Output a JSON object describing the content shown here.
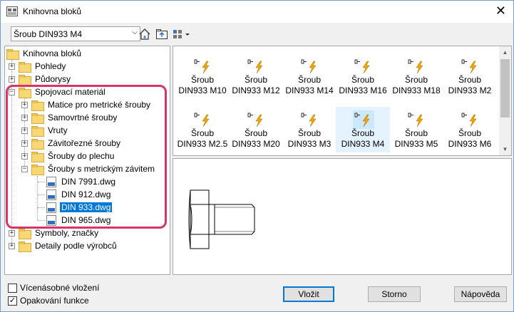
{
  "window": {
    "title": "Knihovna bloků",
    "close_glyph": "✕"
  },
  "toolbar": {
    "combo_value": "Šroub DIN933 M4",
    "icons": [
      "home-icon",
      "folder-up-icon",
      "view-options-icon"
    ]
  },
  "tree": {
    "items": [
      {
        "label": "Knihovna bloků",
        "icon": "folder"
      },
      {
        "label": "Pohledy",
        "icon": "folder",
        "expander": "+"
      },
      {
        "label": "Půdorysy",
        "icon": "folder",
        "expander": "+"
      },
      {
        "label": "Spojovací materiál",
        "icon": "folder",
        "expander": "−"
      },
      {
        "label": "Matice pro metrické šrouby",
        "icon": "folder",
        "expander": "+"
      },
      {
        "label": "Samovrtné šrouby",
        "icon": "folder",
        "expander": "+"
      },
      {
        "label": "Vruty",
        "icon": "folder",
        "expander": "+"
      },
      {
        "label": "Závitořezné šrouby",
        "icon": "folder",
        "expander": "+"
      },
      {
        "label": "Šrouby do plechu",
        "icon": "folder",
        "expander": "+"
      },
      {
        "label": "Šrouby s metrickým závitem",
        "icon": "folder",
        "expander": "−"
      },
      {
        "label": "DIN 7991.dwg",
        "icon": "dwg"
      },
      {
        "label": "DIN 912.dwg",
        "icon": "dwg"
      },
      {
        "label": "DIN 933.dwg",
        "icon": "dwg",
        "selected": true
      },
      {
        "label": "DIN 965.dwg",
        "icon": "dwg"
      },
      {
        "label": "Symboly, značky",
        "icon": "folder",
        "expander": "+"
      },
      {
        "label": "Detaily podle výrobců",
        "icon": "folder",
        "expander": "+"
      }
    ]
  },
  "blocks": {
    "items": [
      {
        "line1": "Šroub",
        "line2": "DIN933 M10"
      },
      {
        "line1": "Šroub",
        "line2": "DIN933 M12"
      },
      {
        "line1": "Šroub",
        "line2": "DIN933 M14"
      },
      {
        "line1": "Šroub",
        "line2": "DIN933 M16"
      },
      {
        "line1": "Šroub",
        "line2": "DIN933 M18"
      },
      {
        "line1": "Šroub",
        "line2": "DIN933 M2"
      },
      {
        "line1": "Šroub",
        "line2": "DIN933 M2.5"
      },
      {
        "line1": "Šroub",
        "line2": "DIN933 M20"
      },
      {
        "line1": "Šroub",
        "line2": "DIN933 M3"
      },
      {
        "line1": "Šroub",
        "line2": "DIN933 M4",
        "selected": true
      },
      {
        "line1": "Šroub",
        "line2": "DIN933 M5"
      },
      {
        "line1": "Šroub",
        "line2": "DIN933 M6"
      }
    ]
  },
  "options": {
    "multi_insert_label": "Vícenásobné vložení",
    "multi_insert_checked": false,
    "repeat_label": "Opakování funkce",
    "repeat_checked": true
  },
  "buttons": {
    "insert": "Vložit",
    "cancel": "Storno",
    "help": "Nápověda"
  },
  "colors": {
    "selection": "#0078d7",
    "highlight_frame": "#d8336b",
    "folder": "#f8d775",
    "lightning": "#f4a400"
  }
}
